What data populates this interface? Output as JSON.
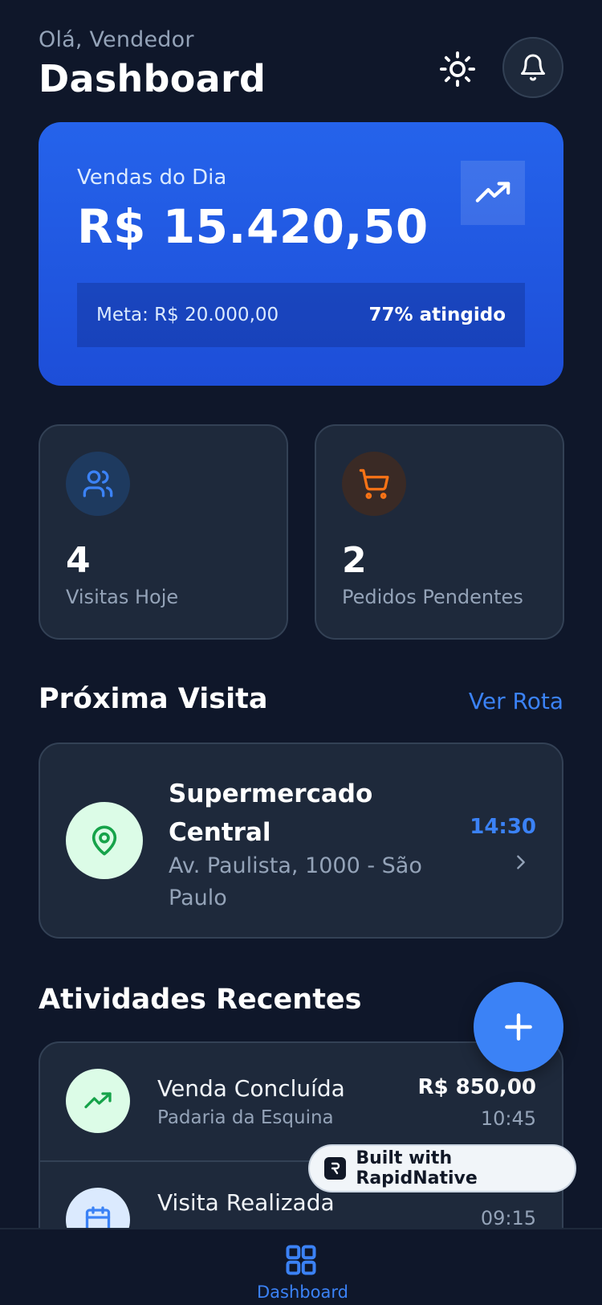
{
  "header": {
    "greeting": "Olá, Vendedor",
    "title": "Dashboard"
  },
  "sales": {
    "label": "Vendas do Dia",
    "value": "R$ 15.420,50",
    "goal": "Meta: R$ 20.000,00",
    "goal_progress": "77% atingido"
  },
  "stats": [
    {
      "value": "4",
      "label": "Visitas Hoje"
    },
    {
      "value": "2",
      "label": "Pedidos Pendentes"
    }
  ],
  "next_visit": {
    "section_title": "Próxima Visita",
    "link": "Ver Rota",
    "name": "Supermercado Central",
    "address": "Av. Paulista, 1000 - São Paulo",
    "time": "14:30"
  },
  "activities": {
    "section_title": "Atividades Recentes",
    "items": [
      {
        "title": "Venda Concluída",
        "subtitle": "Padaria da Esquina",
        "amount": "R$ 850,00",
        "time": "10:45"
      },
      {
        "title": "Visita Realizada",
        "time": "09:15"
      }
    ]
  },
  "badge": {
    "text": "Built with RapidNative"
  },
  "tabbar": {
    "dashboard_label": "Dashboard"
  },
  "colors": {
    "background": "#0f172a",
    "card": "#1e293b",
    "accent": "#3b82f6",
    "success": "#16a34a",
    "warning": "#f97316"
  },
  "icons": [
    "sun-icon",
    "bell-icon",
    "trending-up-icon",
    "users-icon",
    "cart-icon",
    "map-pin-icon",
    "chevron-right-icon",
    "plus-icon",
    "calendar-icon",
    "grid-icon"
  ]
}
